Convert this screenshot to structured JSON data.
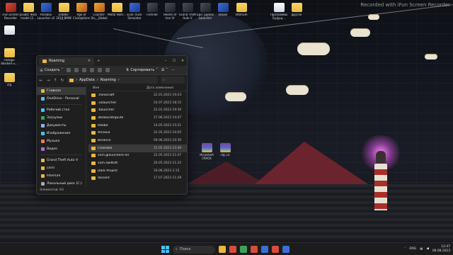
{
  "recording_banner": "Recorded with iFun Screen Recorder",
  "desktop_icons": [
    {
      "label": "iFun Screen Recorder",
      "icon": "recorder-icon",
      "color": "#d94b3b"
    },
    {
      "label": "JEGBO Tesla model (2...",
      "icon": "folder-icon",
      "color": "#e9b83c"
    },
    {
      "label": "Paradox Launcher v2",
      "icon": "paradox-icon",
      "color": "#3b6fd8"
    },
    {
      "label": "3c686c-2019 BMW 58...",
      "icon": "folder-icon",
      "color": "#e9b83c"
    },
    {
      "label": "Age of Civilizations II",
      "icon": "game-icon",
      "color": "#f0a33a"
    },
    {
      "label": "Counter-Str... Global Offe...",
      "icon": "csgo-icon",
      "color": "#f0a33a"
    },
    {
      "label": "Metal Hom...",
      "icon": "folder-icon",
      "color": "#e9b83c"
    },
    {
      "label": "Euro Truck Simulator",
      "icon": "ets-icon",
      "color": "#3b6fd8"
    },
    {
      "label": "Fortnite",
      "icon": "fortnite-icon",
      "color": "#4a4e58"
    },
    {
      "label": "Hearts of Iron IV",
      "icon": "hoi-icon",
      "color": "#4a4e58"
    },
    {
      "label": "Grand Theft Auto V",
      "icon": "gta-icon",
      "color": "#4a4e58"
    },
    {
      "label": "Epic Games Launcher",
      "icon": "epic-icon",
      "color": "#4a4e58"
    },
    {
      "label": "Steam",
      "icon": "steam-icon",
      "color": "#3b6fd8"
    },
    {
      "label": "Interium",
      "icon": "folder-icon",
      "color": "#e9b83c"
    },
    {
      "label": "Программы Будущ...",
      "icon": "document-icon",
      "color": "#ffffff"
    },
    {
      "label": "другое",
      "icon": "folder-icon",
      "color": "#e9b83c"
    }
  ],
  "left_icons": [
    {
      "label": "",
      "icon": "file-icon"
    },
    {
      "label": "clickgui blocked u...",
      "icon": "folder-icon"
    },
    {
      "label": "cfg",
      "icon": "folder-icon"
    }
  ],
  "rar_icons": [
    {
      "label": "INTERIUM CRACK",
      "icon": "winrar-icon"
    },
    {
      "label": "cfg (3)",
      "icon": "winrar-icon"
    }
  ],
  "explorer": {
    "tab_title": "Roaming",
    "new_label": "Создать",
    "sort_label": "Сортировать",
    "breadcrumb": [
      "AppData",
      "Roaming"
    ],
    "nav_items": [
      {
        "label": "Главная",
        "icon": "home-icon",
        "color": "#e9b83c",
        "selected": true
      },
      {
        "label": "OneDrive - Personal",
        "icon": "cloud-icon",
        "color": "#4cc2ff",
        "selected": false
      },
      {
        "label": "Рабочий стол",
        "icon": "desktop-icon",
        "color": "#4cc2ff",
        "selected": false
      },
      {
        "label": "Загрузки",
        "icon": "download-icon",
        "color": "#3aa35a",
        "selected": false
      },
      {
        "label": "Документы",
        "icon": "documents-icon",
        "color": "#8ab4f8",
        "selected": false
      },
      {
        "label": "Изображения",
        "icon": "pictures-icon",
        "color": "#4cc2ff",
        "selected": false
      },
      {
        "label": "Музыка",
        "icon": "music-icon",
        "color": "#f07a5a",
        "selected": false
      },
      {
        "label": "Видео",
        "icon": "video-icon",
        "color": "#b06ae0",
        "selected": false
      },
      {
        "label": "Grand Theft Auto V",
        "icon": "folder-icon",
        "color": "#e9b83c",
        "selected": false
      },
      {
        "label": "cnini",
        "icon": "folder-icon",
        "color": "#e9b83c",
        "selected": false
      },
      {
        "label": "Interium",
        "icon": "folder-icon",
        "color": "#e9b83c",
        "selected": false
      },
      {
        "label": "Локальный диск (C:)",
        "icon": "drive-icon",
        "color": "#aaaaaa",
        "selected": false
      }
    ],
    "columns": {
      "name": "Имя",
      "date": "Дата изменения"
    },
    "files": [
      {
        "name": ".minecraft",
        "date": "22.01.2023 19:23"
      },
      {
        "name": ".rulauncher",
        "date": "24.07.2023 18:15"
      },
      {
        "name": ".tlauncher",
        "date": "22.01.2023 19:30"
      },
      {
        "name": "360DocktopLite",
        "date": "27.06.2023 14:47"
      },
      {
        "name": "Adobe",
        "date": "14.05.2023 15:21"
      },
      {
        "name": "Amneia",
        "date": "22.05.2023 10:05"
      },
      {
        "name": "Binance",
        "date": "09.06.2023 10:39"
      },
      {
        "name": "Chandiol",
        "date": "15.05.2023 13:49"
      },
      {
        "name": "com.gleunchere.hll",
        "date": "22.05.2023 21:07"
      },
      {
        "name": "com.swiftoft",
        "date": "20.05.2023 21:22"
      },
      {
        "name": "Dark Project",
        "date": "16.06.2023 3:15"
      },
      {
        "name": "discord",
        "date": "17.07.2023 11:29"
      }
    ],
    "selected_row": 7,
    "status": "Элементов: 63"
  },
  "taskbar": {
    "search_placeholder": "Поиск",
    "apps": [
      {
        "icon": "explorer-icon",
        "color": "#e9b83c"
      },
      {
        "icon": "yandex-icon",
        "color": "#d94b3b"
      },
      {
        "icon": "chrome-icon",
        "color": "#3aa35a"
      },
      {
        "icon": "opera-icon",
        "color": "#d94b3b"
      },
      {
        "icon": "store-icon",
        "color": "#3b6fd8"
      },
      {
        "icon": "recorder-icon",
        "color": "#d94b3b"
      },
      {
        "icon": "steam-icon",
        "color": "#3b6fd8"
      }
    ],
    "lang": "ENG",
    "time": "12:47",
    "date": "08.08.2023"
  }
}
